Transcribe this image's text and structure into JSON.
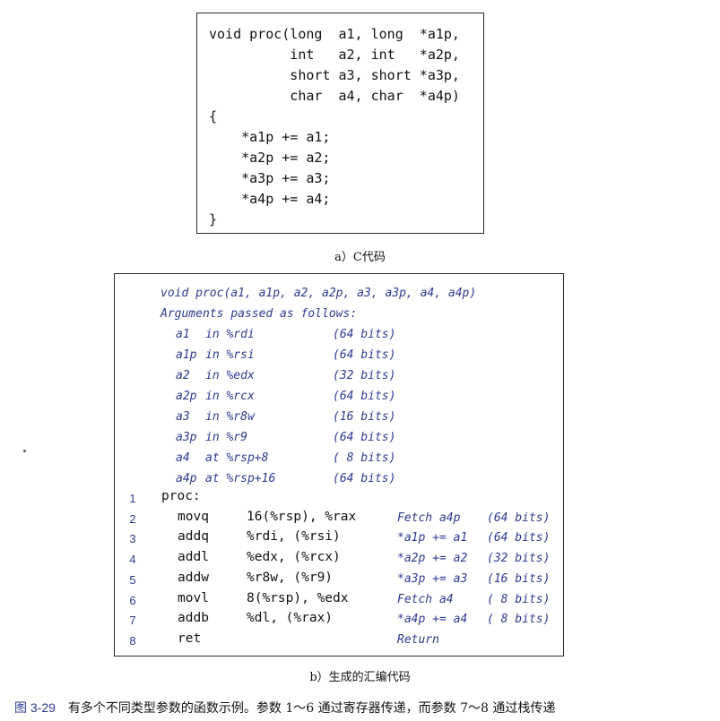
{
  "c_code": {
    "lines": [
      "void proc(long  a1, long  *a1p,",
      "          int   a2, int   *a2p,",
      "          short a3, short *a3p,",
      "          char  a4, char  *a4p)",
      "{",
      "    *a1p += a1;",
      "    *a2p += a2;",
      "    *a3p += a3;",
      "    *a4p += a4;",
      "}"
    ],
    "caption": "a）C代码"
  },
  "asm_header": {
    "signature": "void proc(a1, a1p, a2, a2p, a3, a3p, a4, a4p)",
    "intro": "Arguments passed as follows:",
    "args": [
      {
        "name": "a1",
        "loc": "in %rdi",
        "bits": "(64 bits)"
      },
      {
        "name": "a1p",
        "loc": "in %rsi",
        "bits": "(64 bits)"
      },
      {
        "name": "a2",
        "loc": "in %edx",
        "bits": "(32 bits)"
      },
      {
        "name": "a2p",
        "loc": "in %rcx",
        "bits": "(64 bits)"
      },
      {
        "name": "a3",
        "loc": "in %r8w",
        "bits": "(16 bits)"
      },
      {
        "name": "a3p",
        "loc": "in %r9",
        "bits": "(64 bits)"
      },
      {
        "name": "a4",
        "loc": "at %rsp+8",
        "bits": "( 8 bits)"
      },
      {
        "name": "a4p",
        "loc": "at %rsp+16",
        "bits": "(64 bits)"
      }
    ]
  },
  "asm_code": [
    {
      "num": "1",
      "instr": "proc:",
      "operands": "",
      "comment": "",
      "bits": ""
    },
    {
      "num": "2",
      "instr": "movq",
      "operands": "16(%rsp), %rax",
      "comment": "Fetch a4p",
      "bits": "(64 bits)"
    },
    {
      "num": "3",
      "instr": "addq",
      "operands": "%rdi, (%rsi)",
      "comment": "*a1p += a1",
      "bits": "(64 bits)"
    },
    {
      "num": "4",
      "instr": "addl",
      "operands": "%edx, (%rcx)",
      "comment": "*a2p += a2",
      "bits": "(32 bits)"
    },
    {
      "num": "5",
      "instr": "addw",
      "operands": "%r8w, (%r9)",
      "comment": "*a3p += a3",
      "bits": "(16 bits)"
    },
    {
      "num": "6",
      "instr": "movl",
      "operands": "8(%rsp), %edx",
      "comment": "Fetch a4",
      "bits": "( 8 bits)"
    },
    {
      "num": "7",
      "instr": "addb",
      "operands": "%dl, (%rax)",
      "comment": "*a4p += a4",
      "bits": "( 8 bits)"
    },
    {
      "num": "8",
      "instr": "ret",
      "operands": "",
      "comment": "Return",
      "bits": ""
    }
  ],
  "asm_caption": "b）生成的汇编代码",
  "figure": {
    "number": "图 3-29",
    "caption": "有多个不同类型参数的函数示例。参数 1～6 通过寄存器传递，而参数 7～8 通过栈传递"
  }
}
